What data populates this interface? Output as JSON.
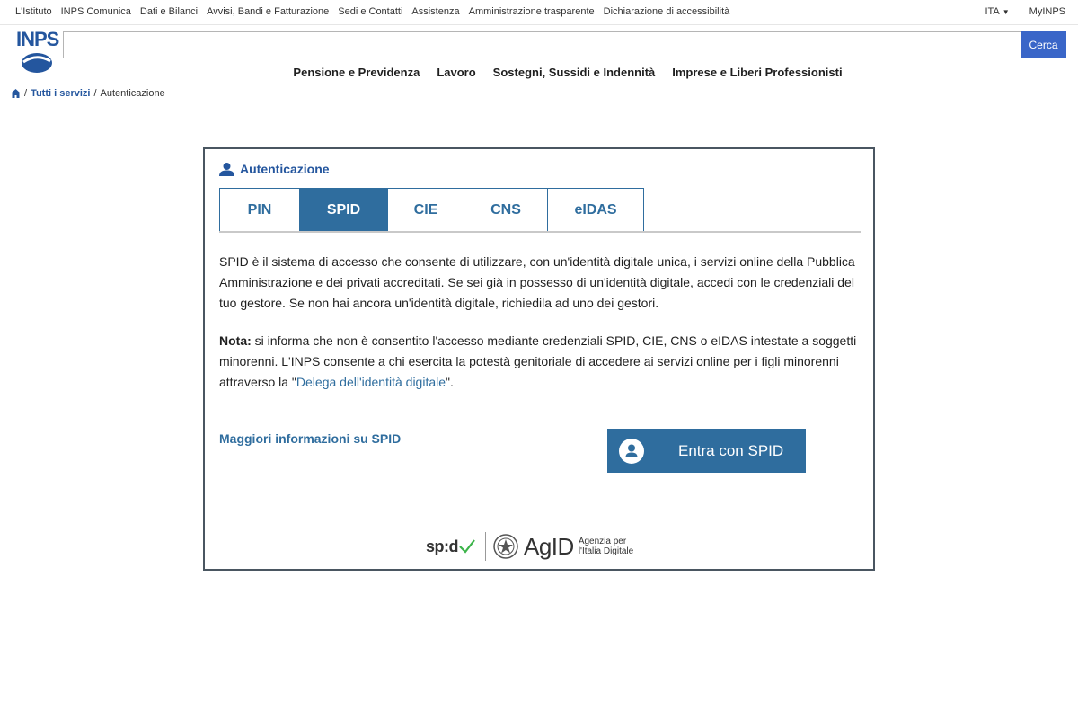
{
  "topnav": {
    "items": [
      "L'Istituto",
      "INPS Comunica",
      "Dati e Bilanci",
      "Avvisi, Bandi e Fatturazione",
      "Sedi e Contatti",
      "Assistenza",
      "Amministrazione trasparente",
      "Dichiarazione di accessibilità"
    ],
    "language": "ITA",
    "myinps": "MyINPS"
  },
  "header": {
    "logo": "INPS",
    "search_placeholder": "",
    "search_button": "Cerca"
  },
  "mainnav": {
    "items": [
      "Pensione e Previdenza",
      "Lavoro",
      "Sostegni, Sussidi e Indennità",
      "Imprese e Liberi Professionisti"
    ]
  },
  "breadcrumb": {
    "link": "Tutti i servizi",
    "current": "Autenticazione"
  },
  "auth": {
    "title": "Autenticazione",
    "tabs": [
      {
        "label": "PIN",
        "active": false
      },
      {
        "label": "SPID",
        "active": true
      },
      {
        "label": "CIE",
        "active": false
      },
      {
        "label": "CNS",
        "active": false
      },
      {
        "label": "eIDAS",
        "active": false
      }
    ],
    "description": "SPID è il sistema di accesso che consente di utilizzare, con un'identità digitale unica, i servizi online della Pubblica Amministrazione e dei privati accreditati. Se sei già in possesso di un'identità digitale, accedi con le credenziali del tuo gestore. Se non hai ancora un'identità digitale, richiedila ad uno dei gestori.",
    "note_label": "Nota:",
    "note_text": " si informa che non è consentito l'accesso mediante credenziali SPID, CIE, CNS o eIDAS intestate a soggetti minorenni. L'INPS consente a chi esercita la potestà genitoriale di accedere ai servizi online per i figli minorenni attraverso la \"",
    "note_link": "Delega dell'identità digitale",
    "note_end": "\".",
    "more_info": "Maggiori informazioni su SPID",
    "spid_button": "Entra con SPID"
  },
  "footer": {
    "spid_logo": "sp:d",
    "agid": "AgID",
    "agid_line1": "Agenzia per",
    "agid_line2": "l'Italia Digitale"
  },
  "colors": {
    "brand_blue": "#24569e",
    "tab_blue": "#2f6d9e",
    "search_button": "#3a66c8",
    "card_border": "#4a5661",
    "spid_check": "#3cb44a"
  },
  "icons": {
    "home": "home-icon",
    "user": "user-icon",
    "spid_user": "user-circle-icon",
    "caret": "chevron-down-icon",
    "emblem": "italian-republic-emblem-icon"
  }
}
